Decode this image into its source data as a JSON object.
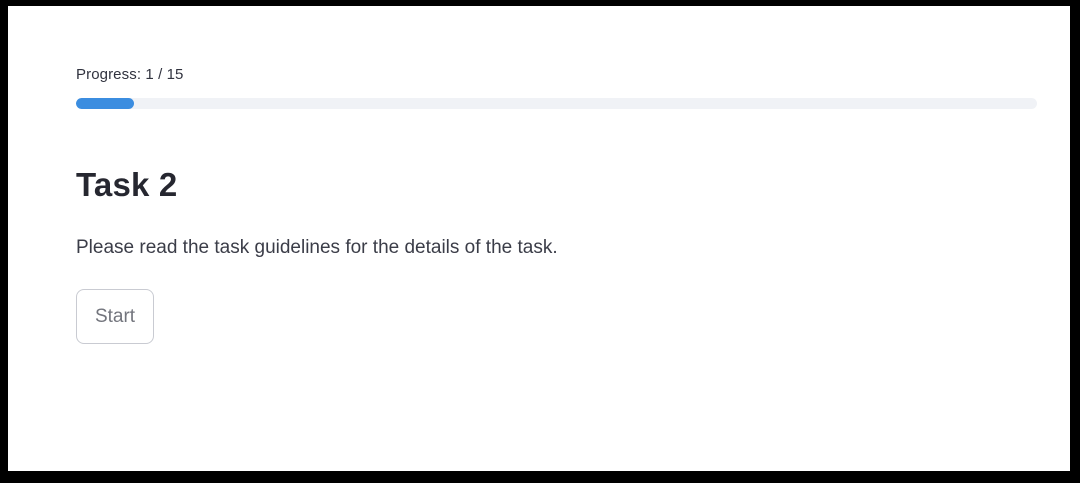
{
  "progress": {
    "label": "Progress: 1 / 15",
    "current": 1,
    "total": 15,
    "fill_fraction": 0.06,
    "fill_color": "#3b8de0",
    "track_color": "#f0f2f6"
  },
  "task": {
    "title": "Task 2",
    "description": "Please read the task guidelines for the details of the task.",
    "start_label": "Start"
  },
  "colors": {
    "frame_border": "#000000",
    "background": "#ffffff",
    "text": "#31333f",
    "button_border": "#c9cbd2",
    "button_text": "#73757d"
  }
}
